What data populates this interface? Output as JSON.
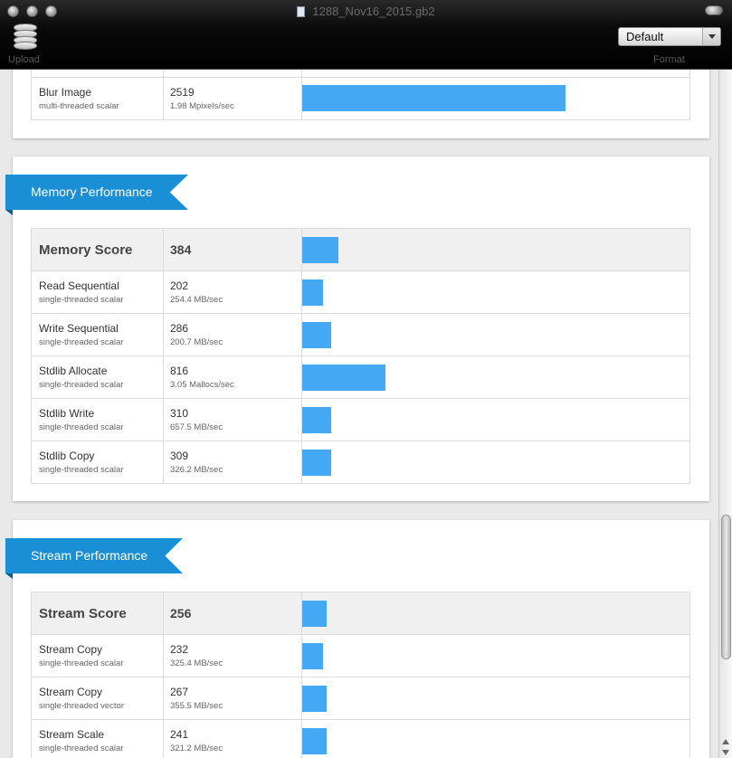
{
  "window": {
    "title": "1288_Nov16_2015.gb2",
    "toolbar": {
      "upload_label": "Upload",
      "format_label": "Format",
      "format_value": "Default"
    }
  },
  "top_section": {
    "rows": [
      {
        "name": "Blur Image",
        "detail": "multi-threaded scalar",
        "score": "2519",
        "rate": "1.98 Mpixels/sec",
        "bar_fraction": 0.68
      }
    ]
  },
  "memory": {
    "title": "Memory Performance",
    "score_label": "Memory Score",
    "score": "384",
    "score_bar_fraction": 0.094,
    "rows": [
      {
        "name": "Read Sequential",
        "detail": "single-threaded scalar",
        "score": "202",
        "rate": "254.4 MB/sec",
        "bar_fraction": 0.054
      },
      {
        "name": "Write Sequential",
        "detail": "single-threaded scalar",
        "score": "286",
        "rate": "200.7 MB/sec",
        "bar_fraction": 0.074
      },
      {
        "name": "Stdlib Allocate",
        "detail": "single-threaded scalar",
        "score": "816",
        "rate": "3.05 Mallocs/sec",
        "bar_fraction": 0.214
      },
      {
        "name": "Stdlib Write",
        "detail": "single-threaded scalar",
        "score": "310",
        "rate": "657.5 MB/sec",
        "bar_fraction": 0.074
      },
      {
        "name": "Stdlib Copy",
        "detail": "single-threaded scalar",
        "score": "309",
        "rate": "326.2 MB/sec",
        "bar_fraction": 0.074
      }
    ]
  },
  "stream": {
    "title": "Stream Performance",
    "score_label": "Stream Score",
    "score": "256",
    "score_bar_fraction": 0.064,
    "rows": [
      {
        "name": "Stream Copy",
        "detail": "single-threaded scalar",
        "score": "232",
        "rate": "325.4 MB/sec",
        "bar_fraction": 0.054
      },
      {
        "name": "Stream Copy",
        "detail": "single-threaded vector",
        "score": "267",
        "rate": "355.5 MB/sec",
        "bar_fraction": 0.064
      },
      {
        "name": "Stream Scale",
        "detail": "single-threaded scalar",
        "score": "241",
        "rate": "321.2 MB/sec",
        "bar_fraction": 0.064
      }
    ]
  },
  "colors": {
    "bar": "#44a8f5",
    "ribbon": "#1a8fd6"
  }
}
